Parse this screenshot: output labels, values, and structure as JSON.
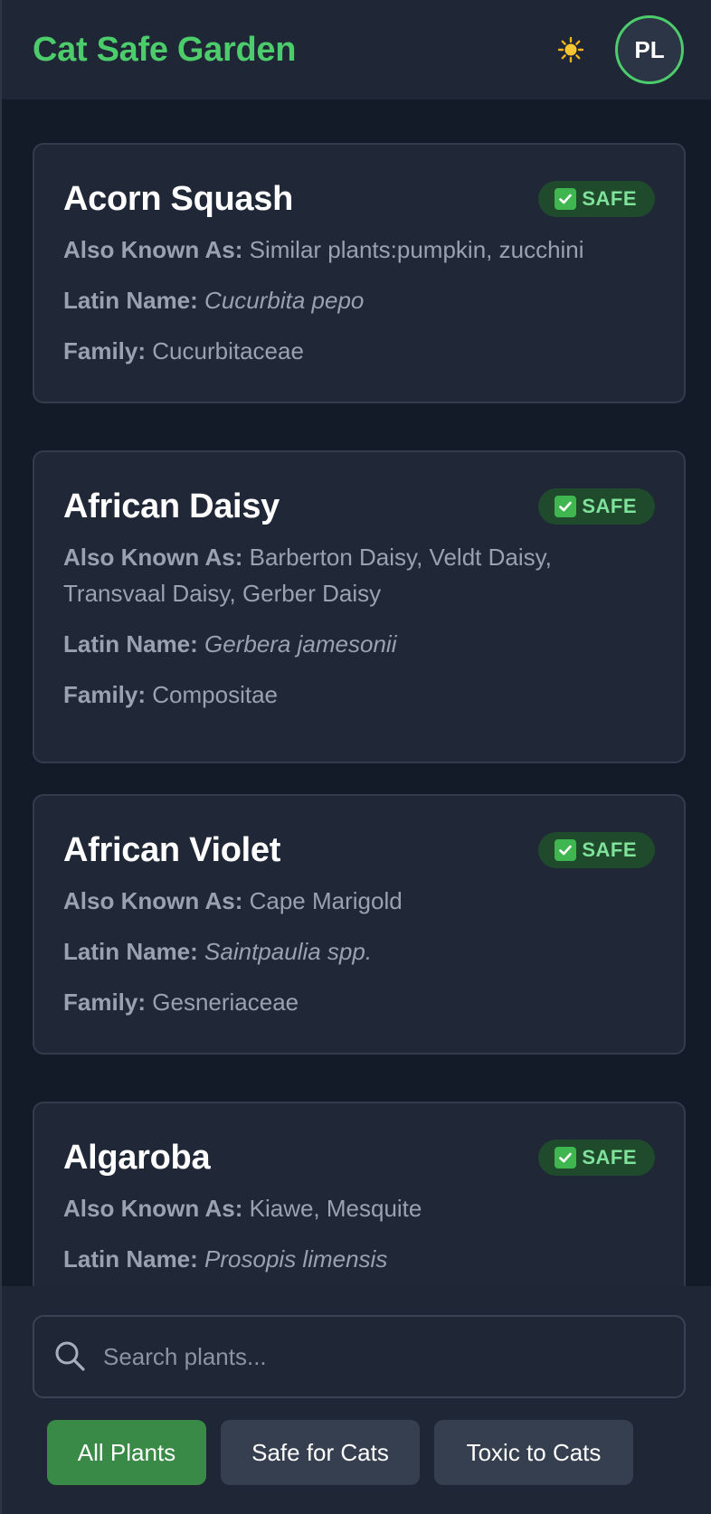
{
  "header": {
    "title": "Cat Safe Garden",
    "theme_icon": "sun-icon",
    "avatar_initials": "PL"
  },
  "labels": {
    "also_known_as": "Also Known As:",
    "latin_name": "Latin Name:",
    "family": "Family:"
  },
  "plants": [
    {
      "name": "Acorn Squash",
      "status": "SAFE",
      "also_known_as": "Similar plants:pumpkin, zucchini",
      "latin_name": "Cucurbita pepo",
      "family": "Cucurbitaceae"
    },
    {
      "name": "African Daisy",
      "status": "SAFE",
      "also_known_as": "Barberton Daisy, Veldt Daisy, Transvaal Daisy, Gerber Daisy",
      "latin_name": "Gerbera jamesonii",
      "family": "Compositae"
    },
    {
      "name": "African Violet",
      "status": "SAFE",
      "also_known_as": "Cape Marigold",
      "latin_name": "Saintpaulia spp.",
      "family": "Gesneriaceae"
    },
    {
      "name": "Algaroba",
      "status": "SAFE",
      "also_known_as": "Kiawe, Mesquite",
      "latin_name": "Prosopis limensis",
      "family": ""
    }
  ],
  "search": {
    "placeholder": "Search plants...",
    "value": ""
  },
  "filters": [
    {
      "label": "All Plants",
      "active": true
    },
    {
      "label": "Safe for Cats",
      "active": false
    },
    {
      "label": "Toxic to Cats",
      "active": false
    }
  ],
  "colors": {
    "brand": "#4ccc6a",
    "safe_badge_bg": "#1f4a2c",
    "active_filter": "#3a8a47"
  }
}
